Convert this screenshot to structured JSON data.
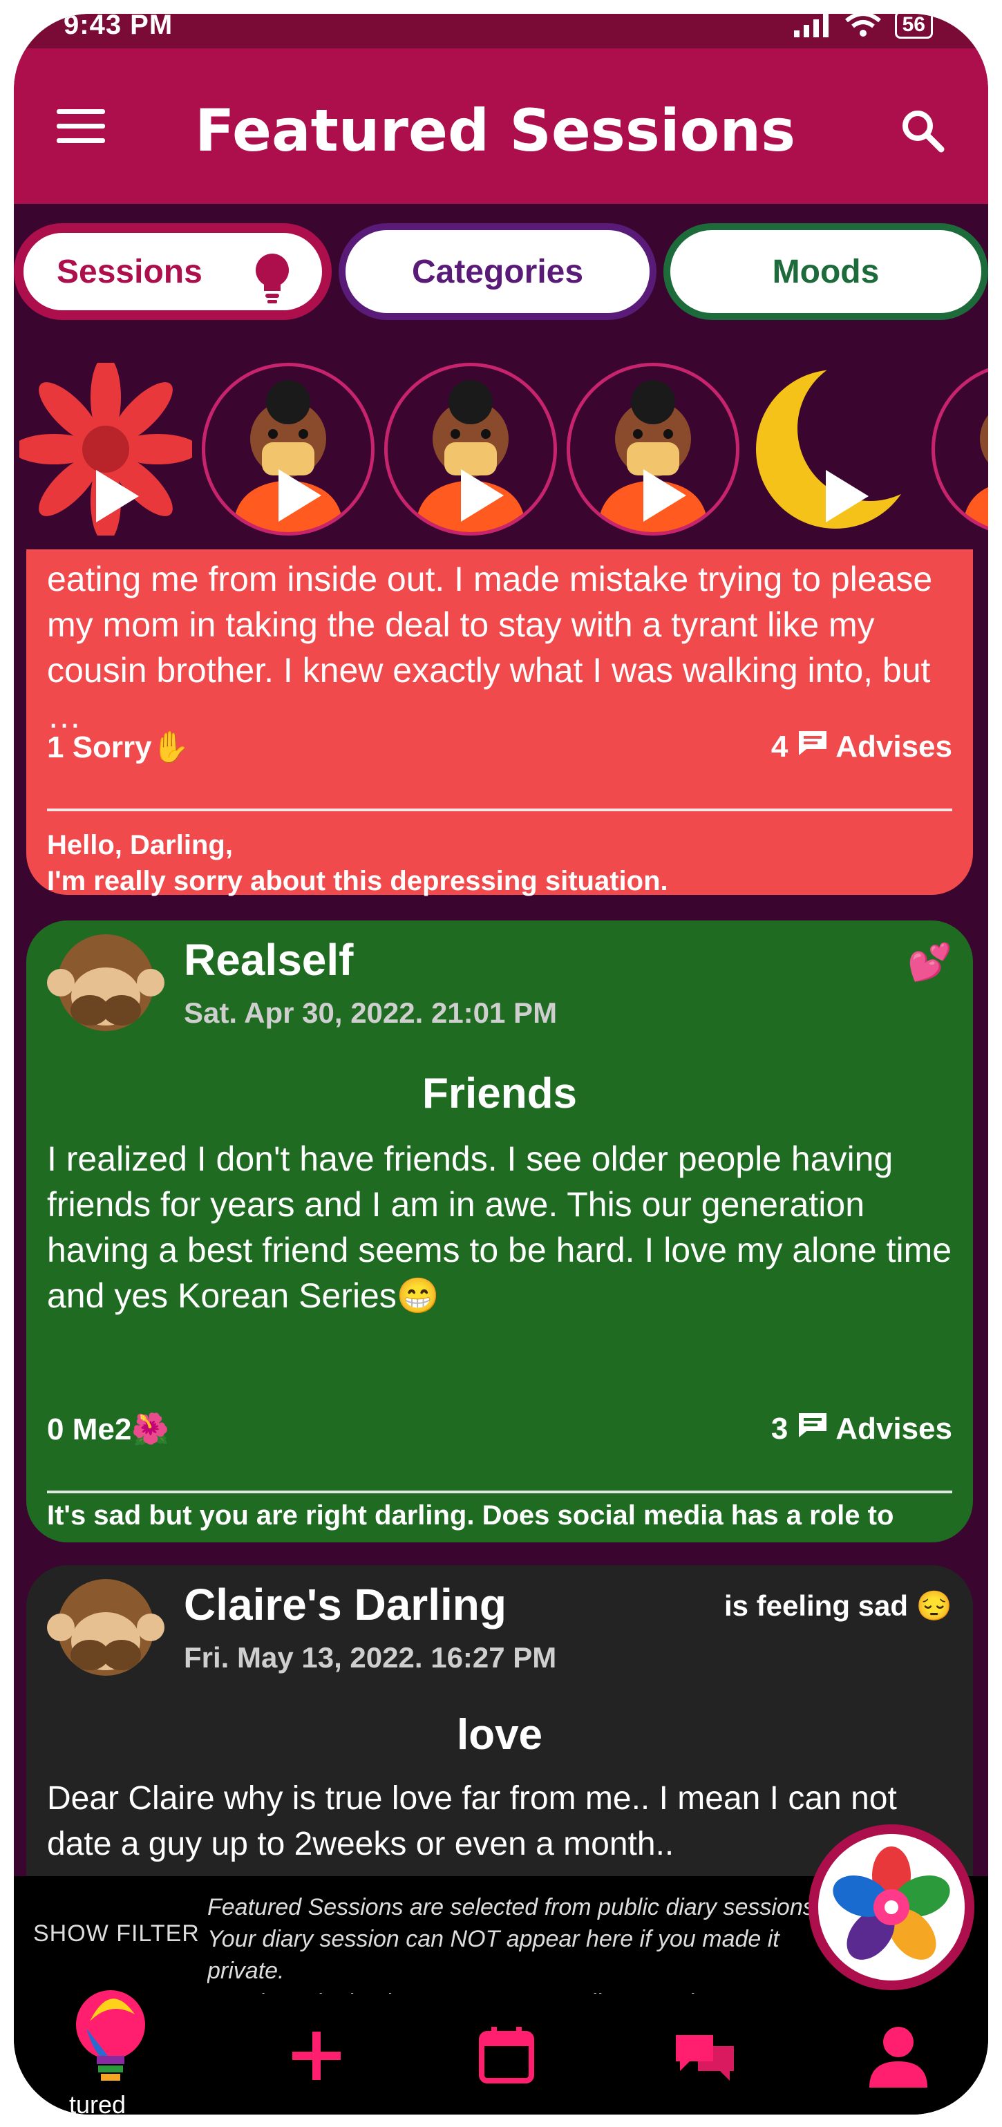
{
  "status_bar": {
    "time": "9:43 PM",
    "battery": "56"
  },
  "app_bar": {
    "title": "Featured Sessions"
  },
  "tabs": [
    {
      "label": "Sessions"
    },
    {
      "label": "Categories"
    },
    {
      "label": "Moods"
    }
  ],
  "cards": [
    {
      "body": "eating me from inside out. I made mistake trying to please my mom in taking the deal to stay with a tyrant like my cousin brother. I knew exactly what I was walking into, but …",
      "left_count": "1 Sorry✋",
      "right_count": "4",
      "right_label": "Advises",
      "reply": "Hello, Darling,\nI'm really sorry about this depressing situation."
    },
    {
      "name": "Realself",
      "date": "Sat. Apr 30, 2022. 21:01 PM",
      "emoji": "💕",
      "title": "Friends",
      "body": "I realized I don't have friends. I see older people having friends for years and I am in awe. This our generation having a best friend seems to be hard. I love my alone time and yes Korean Series😁",
      "left_count": "0 Me2🌺",
      "right_count": "3",
      "right_label": "Advises",
      "reply": "It's sad but you are right darling. Does social media has a role to play in this sociocultural setback? I think so. That's why Claire is here to be a friend …"
    },
    {
      "name": "Claire's Darling",
      "date": "Fri. May 13, 2022. 16:27 PM",
      "feeling": "is feeling sad 😔",
      "title": "love",
      "body": "Dear Claire why is true love far from me.. I mean I can not date a guy up to 2weeks or even a month.."
    }
  ],
  "filter": {
    "label": "SHOW FILTER",
    "info": "Featured Sessions are selected from public diary sessions.\nYour diary session can NOT appear here if you made it private.\nTap the spinning icon to start a new diary session."
  },
  "bottom_nav": {
    "caption": "tured"
  },
  "colors": {
    "appbar": "#ad0f4c",
    "background": "#3a0630",
    "card_red": "#f04a4c",
    "card_green": "#1f6b22",
    "card_dark": "#232323",
    "accent_pink": "#ff1f6e"
  }
}
